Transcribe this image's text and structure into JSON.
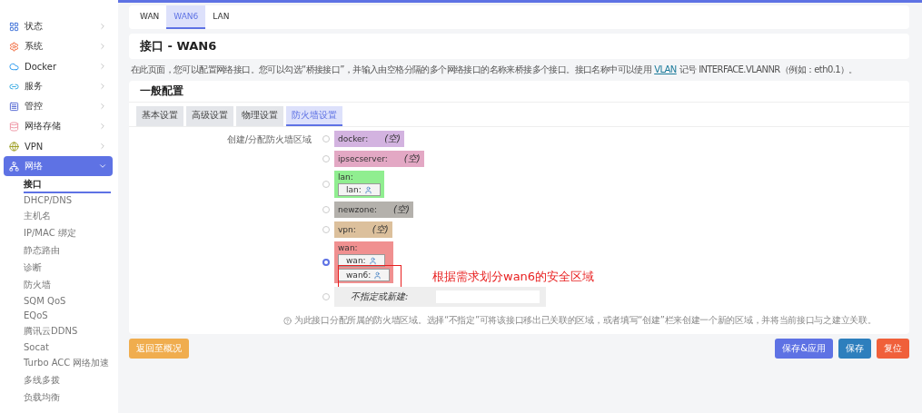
{
  "sidebar": {
    "items": [
      {
        "label": "状态",
        "expanded": false
      },
      {
        "label": "系统",
        "expanded": false
      },
      {
        "label": "Docker",
        "expanded": false
      },
      {
        "label": "服务",
        "expanded": false
      },
      {
        "label": "管控",
        "expanded": false
      },
      {
        "label": "网络存储",
        "expanded": false
      },
      {
        "label": "VPN",
        "expanded": false
      },
      {
        "label": "网络",
        "expanded": true,
        "children": [
          {
            "label": "接口",
            "selected": true
          },
          {
            "label": "DHCP/DNS",
            "selected": false
          },
          {
            "label": "主机名",
            "selected": false
          },
          {
            "label": "IP/MAC 绑定",
            "selected": false
          },
          {
            "label": "静态路由",
            "selected": false
          },
          {
            "label": "诊断",
            "selected": false
          },
          {
            "label": "防火墙",
            "selected": false
          },
          {
            "label": "SQM QoS",
            "selected": false
          },
          {
            "label": "EQoS",
            "selected": false
          },
          {
            "label": "腾讯云DDNS",
            "selected": false
          },
          {
            "label": "Socat",
            "selected": false
          },
          {
            "label": "Turbo ACC 网络加速",
            "selected": false
          },
          {
            "label": "多线多拨",
            "selected": false
          },
          {
            "label": "负载均衡",
            "selected": false
          }
        ]
      }
    ]
  },
  "top_tabs": [
    {
      "label": "WAN",
      "selected": false
    },
    {
      "label": "WAN6",
      "selected": true
    },
    {
      "label": "LAN",
      "selected": false
    }
  ],
  "page_title": "接口 - WAN6",
  "description": {
    "before": "在此页面，您可以配置网络接口。您可以勾选“桥接接口”，并输入由空格分隔的多个网络接口的名称来桥接多个接口。接口名称中可以使用",
    "link": "VLAN",
    "after": "记号 INTERFACE.VLANNR（例如：eth0.1）。"
  },
  "section": {
    "title": "一般配置",
    "tabs": [
      {
        "label": "基本设置",
        "selected": false
      },
      {
        "label": "高级设置",
        "selected": false
      },
      {
        "label": "物理设置",
        "selected": false
      },
      {
        "label": "防火墙设置",
        "selected": true
      }
    ],
    "field_label": "创建/分配防火墙区域",
    "zones": [
      {
        "kind": "zone",
        "name": "docker:",
        "empty": "(空)",
        "color": "#d3b3e0",
        "selected": false
      },
      {
        "kind": "zone",
        "name": "ipsecserver:",
        "empty": "(空)",
        "color": "#e3a8c4",
        "selected": false
      },
      {
        "kind": "zone",
        "name": "lan:",
        "color": "#90ee90",
        "selected": false,
        "members": [
          {
            "label": "lan:",
            "highlighted": false
          }
        ]
      },
      {
        "kind": "zone",
        "name": "newzone:",
        "empty": "(空)",
        "color": "#b4b1ac",
        "selected": false
      },
      {
        "kind": "zone",
        "name": "vpn:",
        "empty": "(空)",
        "color": "#dcc09c",
        "selected": false
      },
      {
        "kind": "zone",
        "name": "wan:",
        "color": "#f09090",
        "selected": true,
        "members": [
          {
            "label": "wan:",
            "highlighted": false
          },
          {
            "label": "wan6:",
            "highlighted": true
          }
        ]
      },
      {
        "kind": "new",
        "label": "不指定或新建:",
        "selected": false
      }
    ],
    "annotation": "根据需求划分wan6的安全区域",
    "help": "为此接口分配所属的防火墙区域。选择“不指定”可将该接口移出已关联的区域，或者填写“创建”栏来创建一个新的区域，并将当前接口与之建立关联。"
  },
  "buttons": [
    {
      "label": "返回至概况",
      "kind": "back"
    },
    {
      "label": "保存&应用",
      "kind": "apply"
    },
    {
      "label": "保存",
      "kind": "save"
    },
    {
      "label": "复位",
      "kind": "reset"
    }
  ]
}
